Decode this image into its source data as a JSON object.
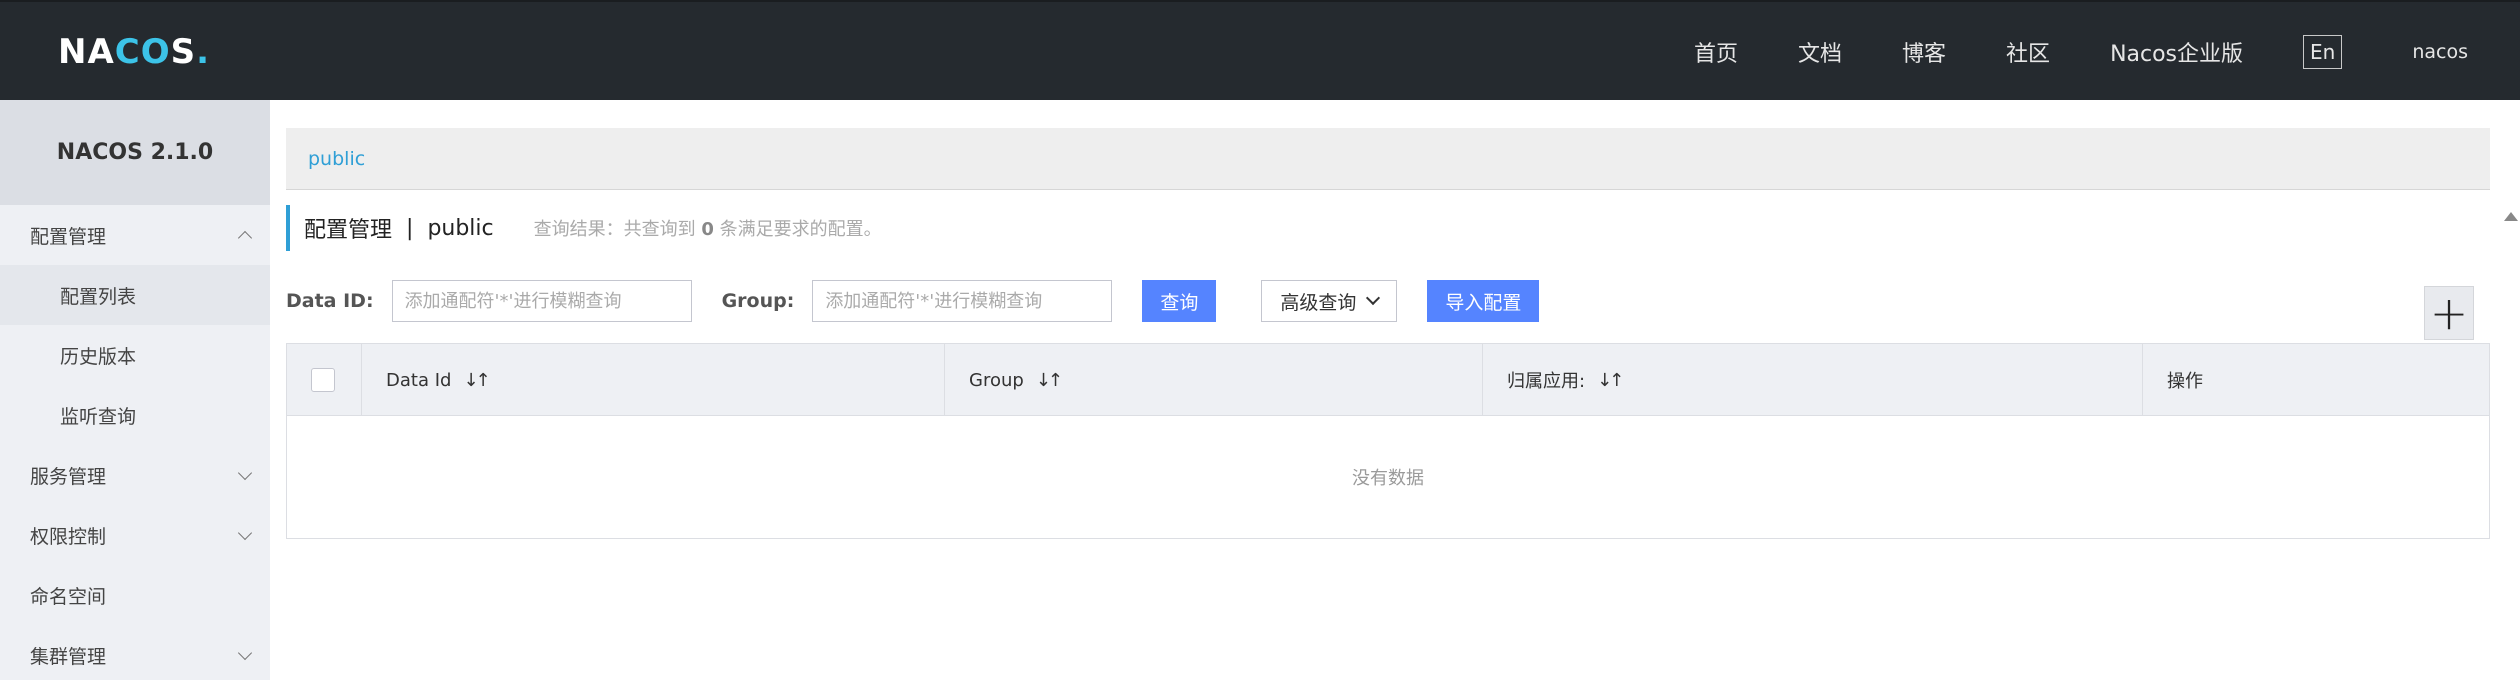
{
  "header": {
    "logo": {
      "na": "NA",
      "co": "CO",
      "s": "S",
      "dot": "."
    },
    "nav": [
      "首页",
      "文档",
      "博客",
      "社区",
      "Nacos企业版"
    ],
    "lang": "En",
    "user": "nacos"
  },
  "sidebar": {
    "title": "NACOS 2.1.0",
    "items": [
      {
        "label": "配置管理"
      },
      {
        "label": "配置列表"
      },
      {
        "label": "历史版本"
      },
      {
        "label": "监听查询"
      },
      {
        "label": "服务管理"
      },
      {
        "label": "权限控制"
      },
      {
        "label": "命名空间"
      },
      {
        "label": "集群管理"
      }
    ]
  },
  "main": {
    "namespace_tab": "public",
    "page_title": "配置管理",
    "separator": "|",
    "page_namespace": "public",
    "query_result_prefix": "查询结果：共查询到",
    "query_result_count": "0",
    "query_result_suffix": "条满足要求的配置。",
    "filters": {
      "data_id_label": "Data ID:",
      "data_id_placeholder": "添加通配符'*'进行模糊查询",
      "group_label": "Group:",
      "group_placeholder": "添加通配符'*'进行模糊查询",
      "query_button": "查询",
      "advanced_button": "高级查询",
      "import_button": "导入配置",
      "add_button": "+"
    },
    "table": {
      "columns": [
        "Data Id",
        "Group",
        "归属应用:",
        "操作"
      ],
      "sort_glyph": "↓↑",
      "empty_text": "没有数据"
    }
  },
  "colors": {
    "header_bg": "#252a2f",
    "accent": "#2f9fd6",
    "primary_button": "#5584ff",
    "sidebar_bg": "#eef0f4"
  }
}
